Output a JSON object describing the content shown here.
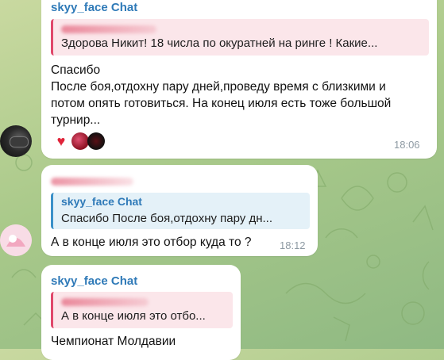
{
  "chat": {
    "messages": [
      {
        "sender": "skyy_face Chat",
        "reply_text": "Здорова Никит! 18 числа по окуратней на ринге ! Какие...",
        "text_lines": [
          "Спасибо",
          "После боя,отдохну пару дней,проведу время с близкими и",
          "потом опять готовиться. На конец июля есть тоже большой",
          "турнир..."
        ],
        "time": "18:06",
        "reactions": [
          "heart",
          "avatar",
          "avatar"
        ]
      },
      {
        "reply_name": "skyy_face Chat",
        "reply_text": "Спасибо После боя,отдохну пару дн...",
        "text": "А в конце июля это отбор куда то ?",
        "time": "18:12"
      },
      {
        "sender": "skyy_face Chat",
        "reply_text": "А в конце июля это отбо...",
        "text": "Чемпионат Молдавии"
      }
    ]
  },
  "colors": {
    "sender": "#2f7ab8",
    "reply_pink_bar": "#e0486b",
    "reply_blue_bar": "#3a90c8",
    "time": "#8e9aa3"
  }
}
